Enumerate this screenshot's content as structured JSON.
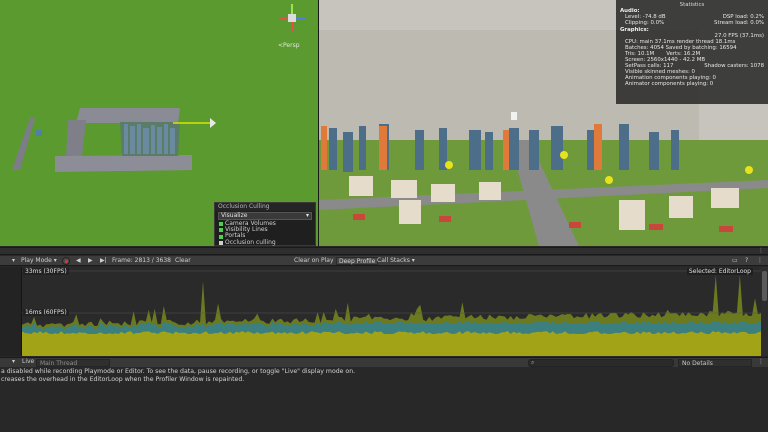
{
  "scene": {
    "persp_label": "<Persp",
    "occlusion_panel": {
      "title": "Occlusion Culling",
      "mode": "Visualize",
      "options": [
        {
          "label": "Camera Volumes",
          "color": "#4fd14f"
        },
        {
          "label": "Visibility Lines",
          "color": "#4fd14f"
        },
        {
          "label": "Portals",
          "color": "#4fd14f"
        }
      ],
      "toggle_label": "Occlusion culling"
    }
  },
  "statistics": {
    "title": "Statistics",
    "audio_header": "Audio:",
    "level": "Level: -74.8 dB",
    "dsp_load": "DSP load: 0.2%",
    "clipping": "Clipping: 0.0%",
    "stream_load": "Stream load: 0.0%",
    "graphics_header": "Graphics:",
    "fps": "27.0 FPS (37.1ms)",
    "cpu": "CPU: main 37.1ms  render thread 18.1ms",
    "batches": "Batches: 4054  Saved by batching: 16594",
    "tris": "Tris: 10.1M",
    "verts": "Verts: 16.2M",
    "screen": "Screen: 2560x1440 - 42.2 MB",
    "setpass": "SetPass calls: 117",
    "shadow_casters": "Shadow casters: 1078",
    "skinned": "Visible skinned meshes: 0",
    "animation": "Animation components playing: 0",
    "animator": "Animator components playing: 0"
  },
  "profiler": {
    "play_mode": "Play Mode",
    "frame": "Frame: 2813 / 3638",
    "clear": "Clear",
    "clear_on_play": "Clear on Play",
    "deep_profile": "Deep Profile",
    "call_stacks": "Call Stacks",
    "label_33ms": "33ms (30FPS)",
    "label_16ms": "16ms (60FPS)",
    "selected": "Selected: EditorLoop",
    "live": "Live",
    "thread": "Main Thread",
    "no_details": "No Details",
    "messages": [
      "a disabled while recording Playmode or Editor. To see the data, pause recording, or toggle \"Live\" display mode on.",
      "creases the overhead in the EditorLoop when the Profiler Window is repainted."
    ]
  },
  "colors": {
    "scene_ground": "#5a9a2e",
    "graph_yellow": "#a3a317",
    "graph_teal": "#3b7f7f",
    "graph_olive": "#6b7a1f"
  }
}
